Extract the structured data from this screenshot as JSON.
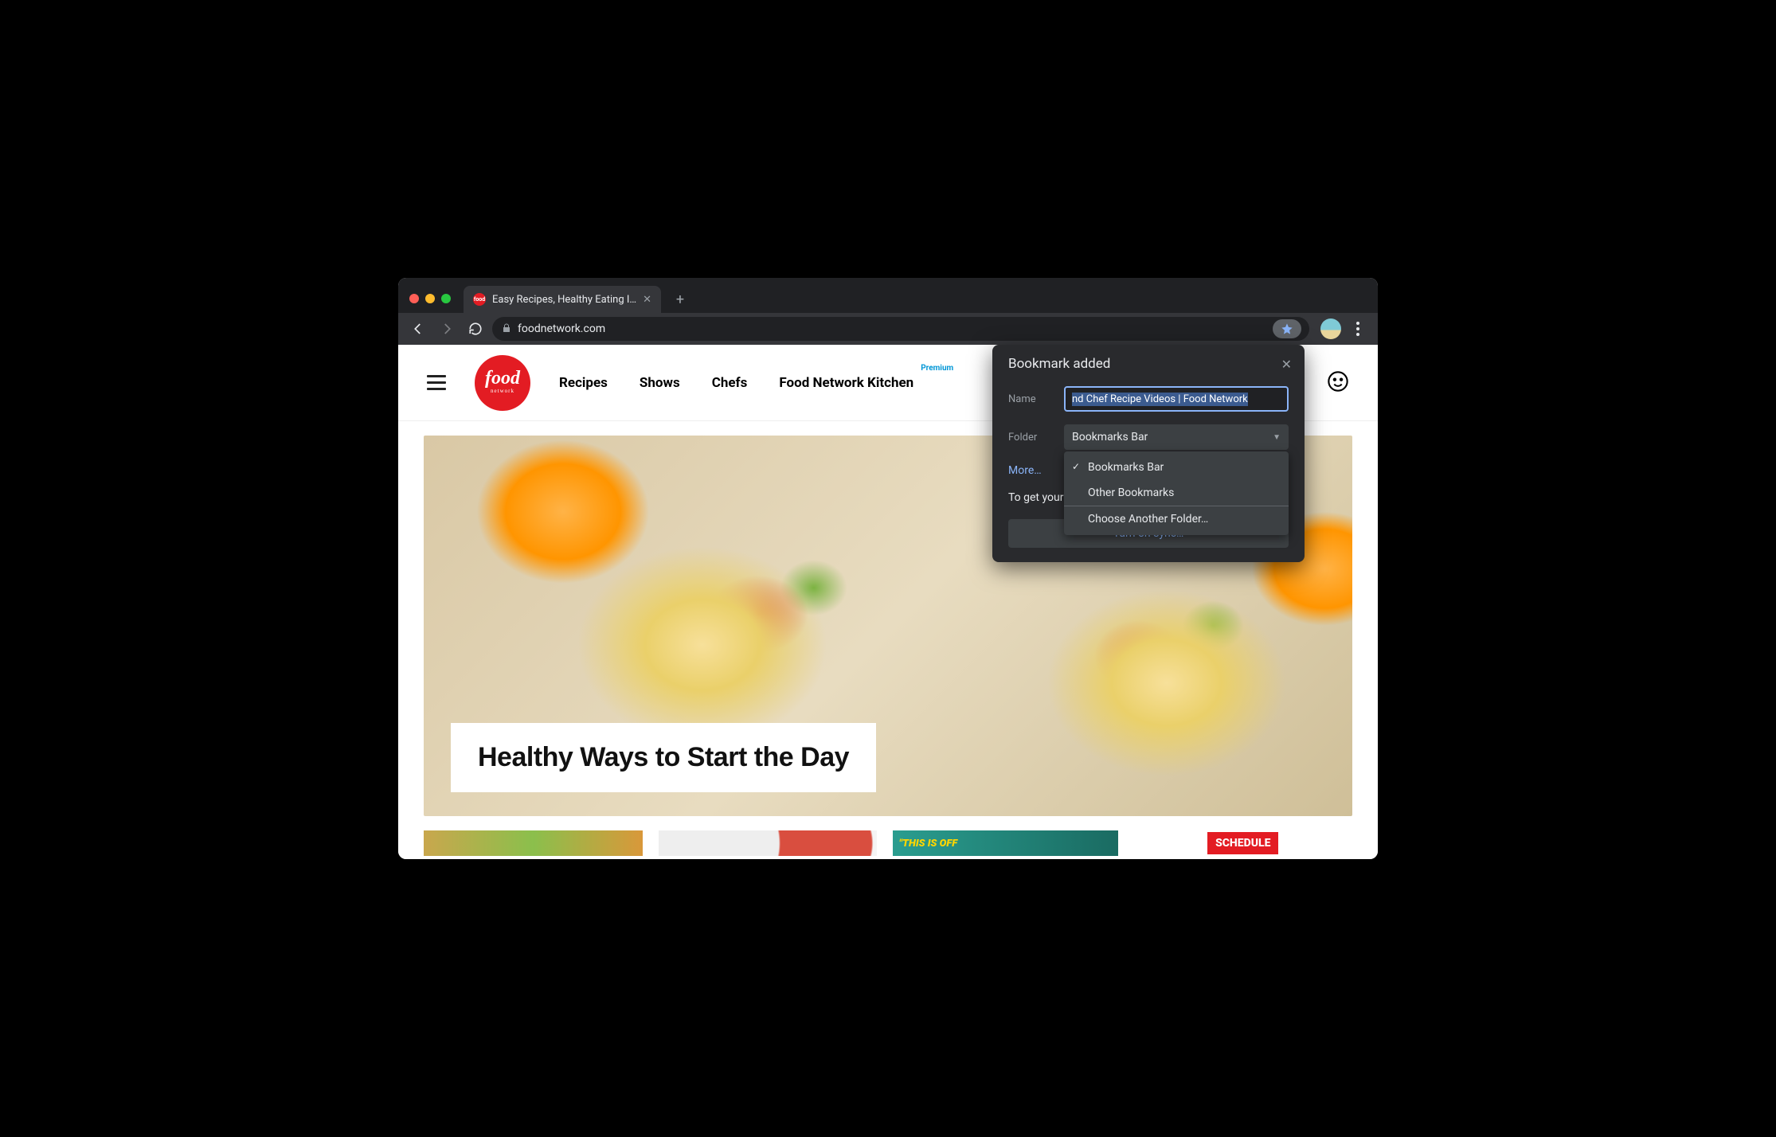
{
  "browser": {
    "tab_title": "Easy Recipes, Healthy Eating I…",
    "url": "foodnetwork.com"
  },
  "site": {
    "logo_big": "food",
    "logo_small": "network",
    "nav": {
      "recipes": "Recipes",
      "shows": "Shows",
      "chefs": "Chefs",
      "kitchen": "Food Network Kitchen",
      "premium": "Premium"
    },
    "hero_title": "Healthy Ways to Start the Day",
    "thumb3_text": "\"THIS IS OFF",
    "schedule_label": "SCHEDULE"
  },
  "popover": {
    "title": "Bookmark added",
    "name_label": "Name",
    "name_value": "nd Chef Recipe Videos | Food Network",
    "folder_label": "Folder",
    "folder_value": "Bookmarks Bar",
    "dropdown": {
      "item1": "Bookmarks Bar",
      "item2": "Other Bookmarks",
      "item3": "Choose Another Folder…"
    },
    "more": "More…",
    "sync_text": "To get your bookmarks on all your devices, turn on sync.",
    "sync_button": "Turn on sync…"
  }
}
